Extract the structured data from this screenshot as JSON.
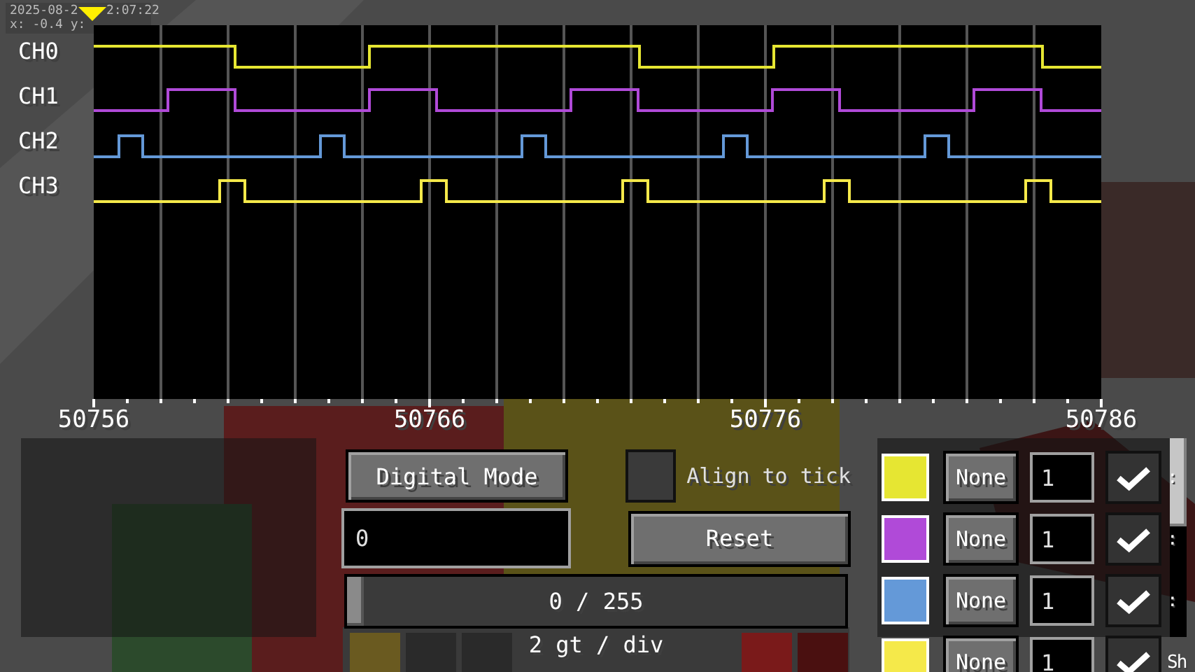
{
  "debug_overlay": {
    "lines": [
      "2025-08-2",
      "2:07:22",
      "x: -0.4 y:"
    ]
  },
  "plot": {
    "channel_labels": [
      "CH0",
      "CH1",
      "CH2",
      "CH3"
    ],
    "axis_labels": [
      "50756",
      "50766",
      "50776",
      "50786"
    ]
  },
  "controls": {
    "mode_button": "Digital Mode",
    "align": {
      "label": "Align to tick",
      "checked": false
    },
    "offset_field": {
      "value": "0"
    },
    "reset_button": "Reset",
    "slider": {
      "text": "0 / 255",
      "level": 0
    },
    "scale": "2 gt / div"
  },
  "channels": [
    {
      "color": "#e6e632",
      "trigger": "None",
      "value": "1",
      "enabled": true,
      "label": ":"
    },
    {
      "color": "#b04ad8",
      "trigger": "None",
      "value": "1",
      "enabled": true,
      "label": ":"
    },
    {
      "color": "#6499d8",
      "trigger": "None",
      "value": "1",
      "enabled": true,
      "label": ":"
    },
    {
      "color": "#f5e94a",
      "trigger": "None",
      "value": "1",
      "enabled": true,
      "label": "Sh"
    }
  ]
}
